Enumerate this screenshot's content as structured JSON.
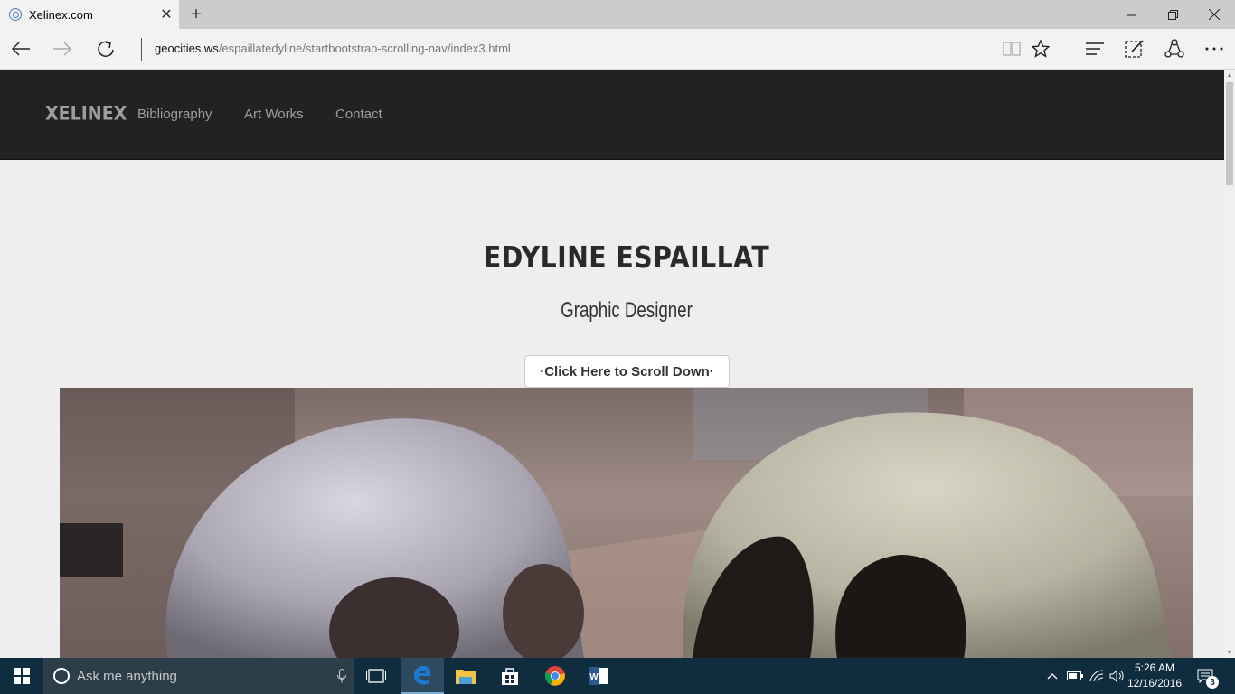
{
  "browser": {
    "tab_title": "Xelinex.com",
    "url_host": "geocities.ws",
    "url_path": "/espaillatedyline/startbootstrap-scrolling-nav/index3.html"
  },
  "site": {
    "brand": "XELINEX",
    "nav": [
      "Bibliography",
      "Art Works",
      "Contact"
    ],
    "title": "EDYLINE ESPAILLAT",
    "subtitle": "Graphic Designer",
    "scroll_button": "·Click Here to Scroll Down·"
  },
  "taskbar": {
    "search_placeholder": "Ask me anything",
    "time": "5:26 AM",
    "date": "12/16/2016",
    "notifications": "3"
  },
  "colors": {
    "site_nav_bg": "#222222",
    "taskbar_bg": "#0f2d3f",
    "edge_blue": "#1e78d2"
  }
}
